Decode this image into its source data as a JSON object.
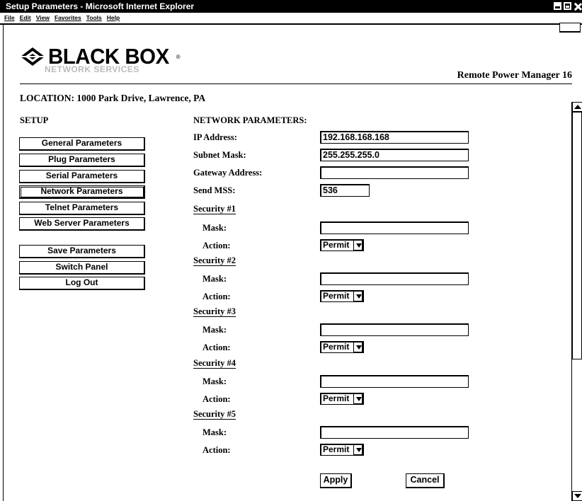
{
  "window": {
    "title": "Setup Parameters - Microsoft Internet Explorer"
  },
  "menu": {
    "items": [
      "File",
      "Edit",
      "View",
      "Favorites",
      "Tools",
      "Help"
    ]
  },
  "brand": {
    "logo_text": "BLACK BOX",
    "logo_sub": "NETWORK SERVICES",
    "product": "Remote Power Manager 16"
  },
  "location": "LOCATION: 1000 Park Drive, Lawrence, PA",
  "sidebar": {
    "title": "SETUP",
    "items": [
      {
        "label": "General Parameters"
      },
      {
        "label": "Plug Parameters"
      },
      {
        "label": "Serial Parameters"
      },
      {
        "label": "Network Parameters",
        "active": true
      },
      {
        "label": "Telnet Parameters"
      },
      {
        "label": "Web Server Parameters"
      },
      {
        "label": "Save Parameters"
      },
      {
        "label": "Switch Panel"
      },
      {
        "label": "Log Out"
      }
    ]
  },
  "form": {
    "title": "NETWORK PARAMETERS:",
    "ip_label": "IP Address:",
    "ip_value": "192.168.168.168",
    "subnet_label": "Subnet Mask:",
    "subnet_value": "255.255.255.0",
    "gateway_label": "Gateway Address:",
    "gateway_value": "",
    "mss_label": "Send MSS:",
    "mss_value": "536",
    "mask_label": "Mask:",
    "action_label": "Action:",
    "security": [
      {
        "title": "Security #1",
        "mask": "",
        "action": "Permit"
      },
      {
        "title": "Security #2",
        "mask": "",
        "action": "Permit"
      },
      {
        "title": "Security #3",
        "mask": "",
        "action": "Permit"
      },
      {
        "title": "Security #4",
        "mask": "",
        "action": "Permit"
      },
      {
        "title": "Security #5",
        "mask": "",
        "action": "Permit"
      }
    ],
    "apply_label": "Apply",
    "cancel_label": "Cancel"
  }
}
